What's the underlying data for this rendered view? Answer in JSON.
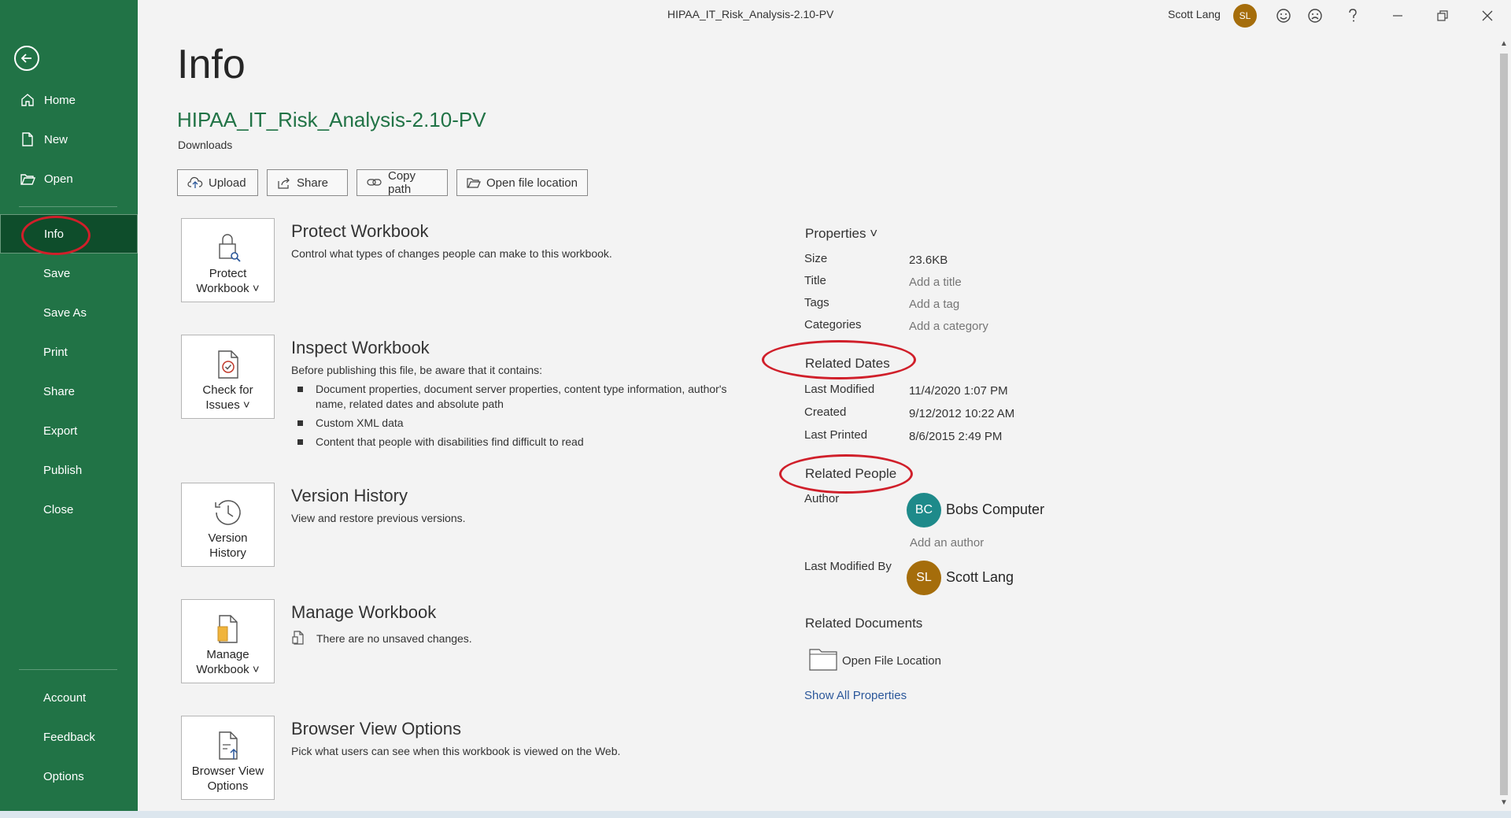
{
  "titlebar": {
    "doc_title": "HIPAA_IT_Risk_Analysis-2.10-PV",
    "user_name": "Scott Lang",
    "user_initials": "SL"
  },
  "sidebar": {
    "items": [
      {
        "label": "Home",
        "icon": "home-icon"
      },
      {
        "label": "New",
        "icon": "new-document-icon"
      },
      {
        "label": "Open",
        "icon": "folder-open-icon"
      },
      {
        "label": "Info"
      },
      {
        "label": "Save"
      },
      {
        "label": "Save As"
      },
      {
        "label": "Print"
      },
      {
        "label": "Share"
      },
      {
        "label": "Export"
      },
      {
        "label": "Publish"
      },
      {
        "label": "Close"
      },
      {
        "label": "Account"
      },
      {
        "label": "Feedback"
      },
      {
        "label": "Options"
      }
    ],
    "accent_color": "#217346",
    "active_color": "#0e4d2b"
  },
  "main": {
    "page_title": "Info",
    "file_name": "HIPAA_IT_Risk_Analysis-2.10-PV",
    "file_location": "Downloads",
    "actions": {
      "upload": "Upload",
      "share": "Share",
      "copy_path": "Copy path",
      "open_location": "Open file location"
    },
    "sections": {
      "protect": {
        "button_line1": "Protect",
        "button_line2": "Workbook ˅",
        "title": "Protect Workbook",
        "desc": "Control what types of changes people can make to this workbook."
      },
      "inspect": {
        "button_line1": "Check for",
        "button_line2": "Issues ˅",
        "title": "Inspect Workbook",
        "desc": "Before publishing this file, be aware that it contains:",
        "bullets": [
          "Document properties, document server properties, content type information, author's name, related dates and absolute path",
          "Custom XML data",
          "Content that people with disabilities find difficult to read"
        ]
      },
      "version": {
        "button_line1": "Version",
        "button_line2": "History",
        "title": "Version History",
        "desc": "View and restore previous versions."
      },
      "manage": {
        "button_line1": "Manage",
        "button_line2": "Workbook ˅",
        "title": "Manage Workbook",
        "desc": "There are no unsaved changes."
      },
      "browser": {
        "button_line1": "Browser View",
        "button_line2": "Options",
        "title": "Browser View Options",
        "desc": "Pick what users can see when this workbook is viewed on the Web."
      }
    }
  },
  "properties": {
    "header": "Properties ˅",
    "size_label": "Size",
    "size_value": "23.6KB",
    "title_label": "Title",
    "title_value": "Add a title",
    "tags_label": "Tags",
    "tags_value": "Add a tag",
    "categories_label": "Categories",
    "categories_value": "Add a category",
    "related_dates": "Related Dates",
    "last_modified_label": "Last Modified",
    "last_modified_value": "11/4/2020 1:07 PM",
    "created_label": "Created",
    "created_value": "9/12/2012 10:22 AM",
    "last_printed_label": "Last Printed",
    "last_printed_value": "8/6/2015 2:49 PM",
    "related_people": "Related People",
    "author_label": "Author",
    "author_initials": "BC",
    "author_name": "Bobs Computer",
    "author_color": "#1e8a8a",
    "add_author": "Add an author",
    "last_modified_by_label": "Last Modified By",
    "modifier_initials": "SL",
    "modifier_name": "Scott Lang",
    "modifier_color": "#a56d0b",
    "related_documents": "Related Documents",
    "open_file_location": "Open File Location",
    "show_all": "Show All Properties"
  }
}
